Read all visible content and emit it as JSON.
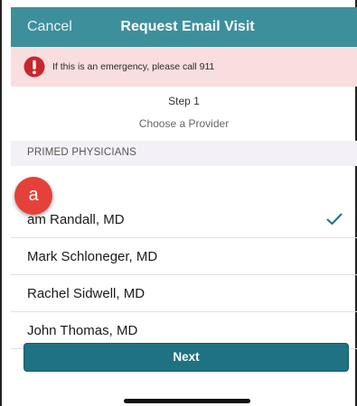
{
  "header": {
    "cancel_label": "Cancel",
    "title": "Request Email Visit"
  },
  "alert": {
    "icon": "alert-circle-icon",
    "text": "If this is an emergency, please call 911",
    "color": "#c8262c"
  },
  "step": {
    "number": "Step 1",
    "subtitle": "Choose a Provider"
  },
  "section": {
    "title": "PRIMED PHYSICIANS"
  },
  "providers": [
    {
      "name": "am Randall, MD",
      "selected": true
    },
    {
      "name": "Mark Schloneger, MD",
      "selected": false
    },
    {
      "name": "Rachel Sidwell, MD",
      "selected": false
    },
    {
      "name": "John Thomas, MD",
      "selected": false
    }
  ],
  "annotation_badge": "a",
  "next_label": "Next",
  "colors": {
    "nav": "#3d8f9c",
    "button": "#1f7282",
    "alert_bg": "#f9dedf",
    "check": "#1f7282",
    "badge": "#e5413a"
  }
}
